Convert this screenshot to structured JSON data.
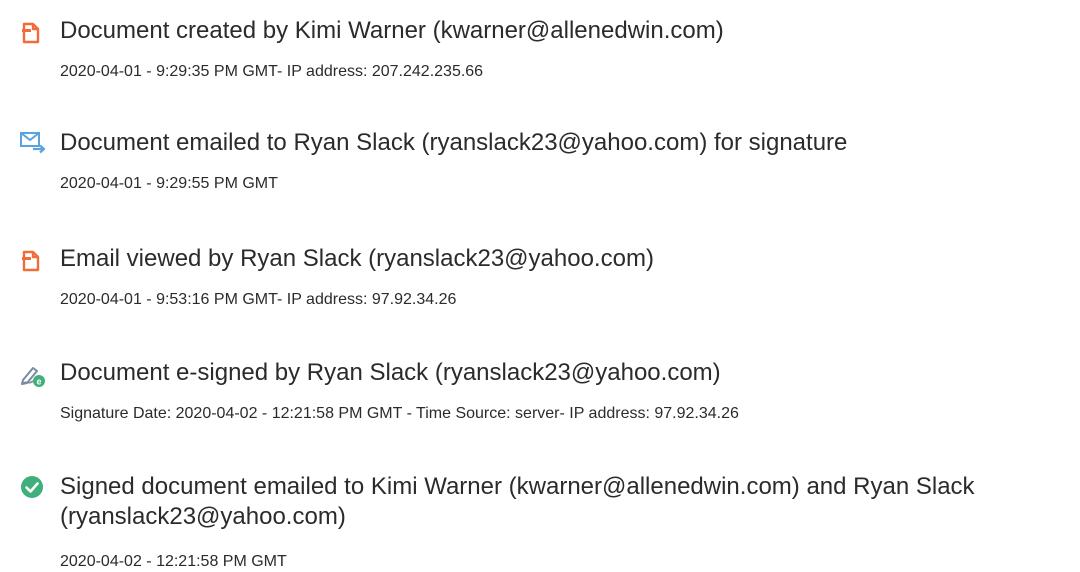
{
  "events": [
    {
      "icon": "document-created-icon",
      "title": "Document created by Kimi Warner (kwarner@allenedwin.com)",
      "meta": "2020-04-01 - 9:29:35 PM GMT- IP address: 207.242.235.66"
    },
    {
      "icon": "email-sent-icon",
      "title": "Document emailed to Ryan Slack (ryanslack23@yahoo.com) for signature",
      "meta": "2020-04-01 - 9:29:55 PM GMT"
    },
    {
      "icon": "email-viewed-icon",
      "title": "Email viewed by Ryan Slack (ryanslack23@yahoo.com)",
      "meta": "2020-04-01 - 9:53:16 PM GMT- IP address: 97.92.34.26"
    },
    {
      "icon": "e-signed-icon",
      "title": "Document e-signed by Ryan Slack (ryanslack23@yahoo.com)",
      "meta": "Signature Date: 2020-04-02 - 12:21:58 PM GMT - Time Source: server- IP address: 97.92.34.26"
    },
    {
      "icon": "completed-check-icon",
      "title": "Signed document emailed to Kimi Warner (kwarner@allenedwin.com) and Ryan Slack (ryanslack23@yahoo.com)",
      "meta": "2020-04-02 - 12:21:58 PM GMT"
    }
  ],
  "colors": {
    "document_icon": "#f26b3a",
    "email_icon": "#5aa3e0",
    "signed_icon": "#7a8aa0",
    "signed_badge": "#3fb07c",
    "check_circle": "#3fb07c",
    "text": "#2b2b2b"
  }
}
